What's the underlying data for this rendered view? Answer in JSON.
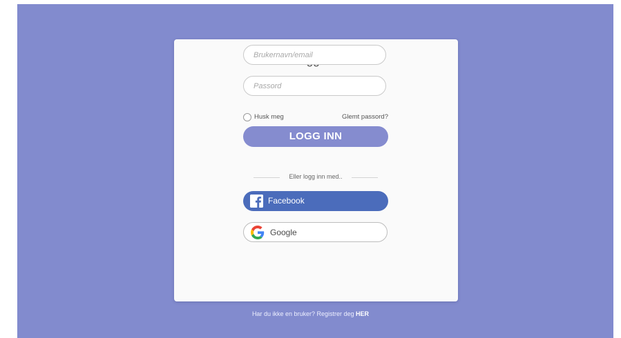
{
  "login": {
    "title": "Logg inn",
    "username_placeholder": "Brukernavn/email",
    "password_placeholder": "Passord",
    "remember_label": "Husk meg",
    "forgot_label": "Glemt passord?",
    "submit_label": "LOGG INN",
    "divider_text": "Eller logg inn med..",
    "facebook_label": "Facebook",
    "google_label": "Google"
  },
  "footer": {
    "text": "Har du ikke en bruker? Registrer deg",
    "link_label": "HER"
  },
  "colors": {
    "background": "#828bce",
    "accent": "#858ccf",
    "facebook": "#4b6cbb"
  },
  "icons": {
    "facebook": "facebook-icon",
    "google": "google-icon"
  }
}
